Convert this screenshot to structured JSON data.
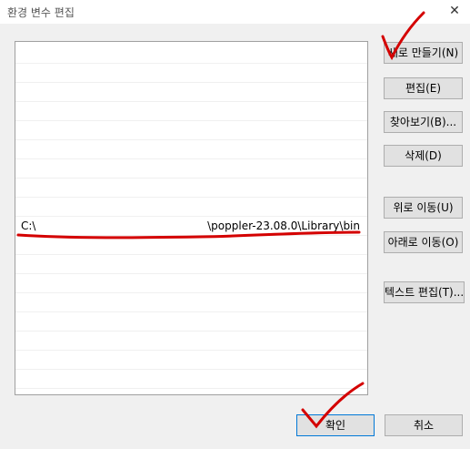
{
  "window": {
    "title": "환경 변수 편집",
    "close_glyph": "✕"
  },
  "list": {
    "selected_row_index": 10,
    "selected_path_start": "C:\\",
    "selected_path_end": "\\poppler-23.08.0\\Library\\bin"
  },
  "buttons": {
    "new": "새로 만들기(N)",
    "edit": "편집(E)",
    "browse": "찾아보기(B)...",
    "delete": "삭제(D)",
    "move_up": "위로 이동(U)",
    "move_down": "아래로 이동(O)",
    "edit_text": "텍스트 편집(T)...",
    "ok": "확인",
    "cancel": "취소"
  },
  "annotations": {
    "color": "#d40000"
  }
}
